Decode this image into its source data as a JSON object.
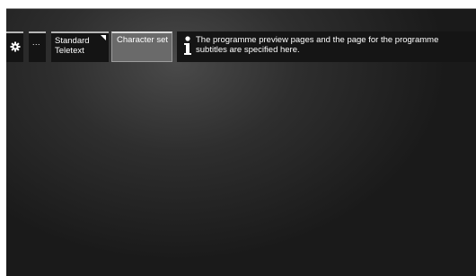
{
  "menu": {
    "icons": {
      "settings": "gear-icon",
      "info": "info-icon",
      "dropdown": "corner-triangle-icon"
    },
    "more_label": "...",
    "option_label": "Standard Teletext",
    "selected_label": "Character set"
  },
  "info": {
    "text": "The programme preview pages and the page for the programme subtitles are specified here."
  },
  "colors": {
    "background": "#2a2a2a",
    "tile": "#141414",
    "selected_tile": "#6a6a6a",
    "text": "#ffffff"
  }
}
